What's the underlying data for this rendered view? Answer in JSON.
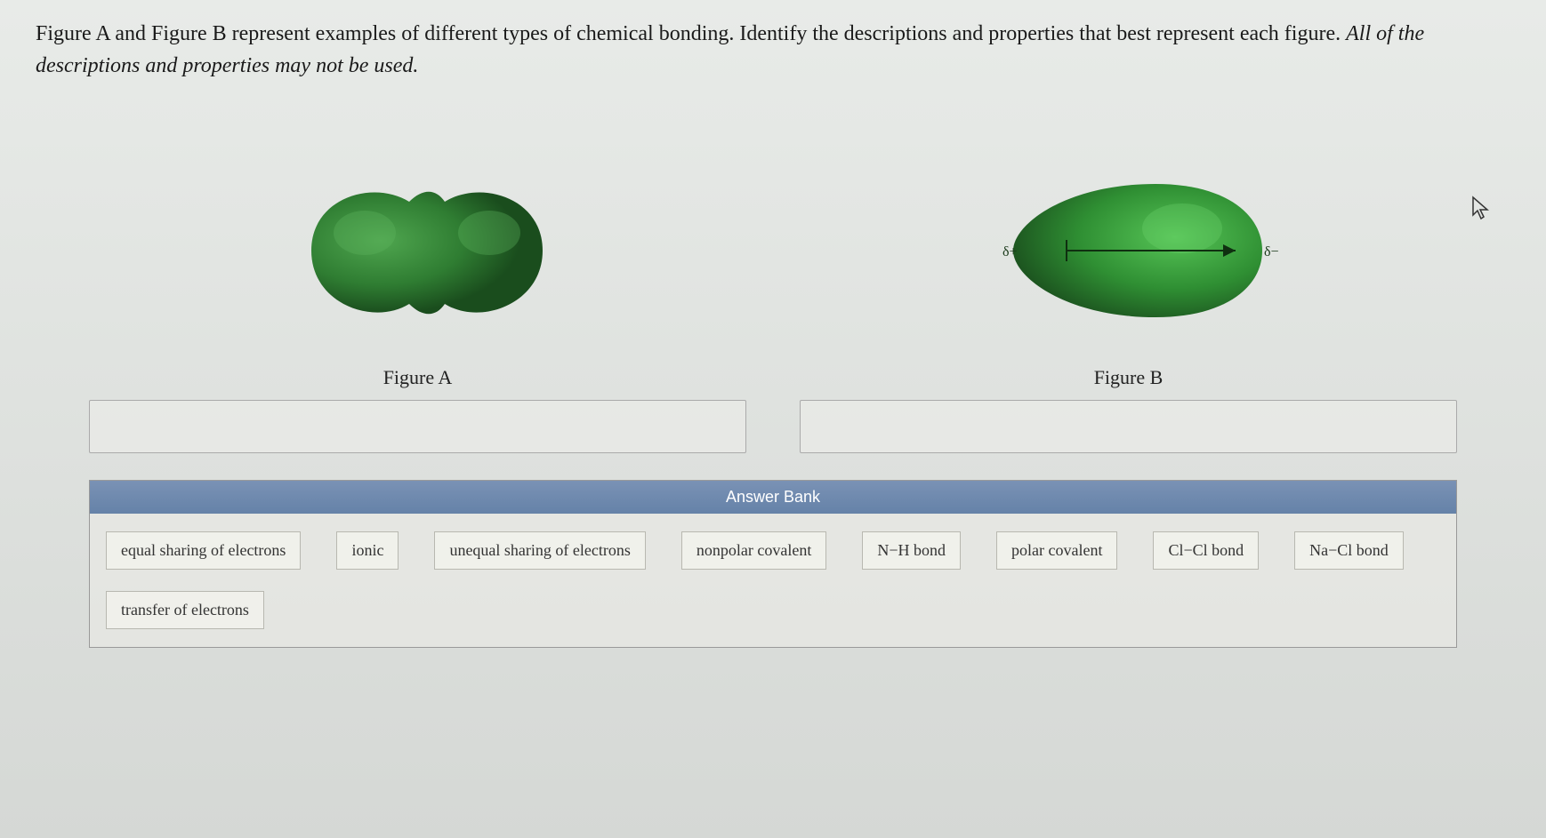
{
  "question": {
    "main": "Figure A and Figure B represent examples of different types of chemical bonding. Identify the descriptions and properties that best represent each figure. ",
    "italic": "All of the descriptions and properties may not be used."
  },
  "figures": {
    "a": {
      "label": "Figure A"
    },
    "b": {
      "label": "Figure B",
      "delta_plus": "δ+",
      "delta_minus": "δ−"
    }
  },
  "answer_bank": {
    "header": "Answer Bank",
    "tiles": [
      "equal sharing of electrons",
      "ionic",
      "unequal sharing of electrons",
      "nonpolar covalent",
      "N−H bond",
      "polar covalent",
      "Cl−Cl bond",
      "Na−Cl bond",
      "transfer of electrons"
    ]
  }
}
